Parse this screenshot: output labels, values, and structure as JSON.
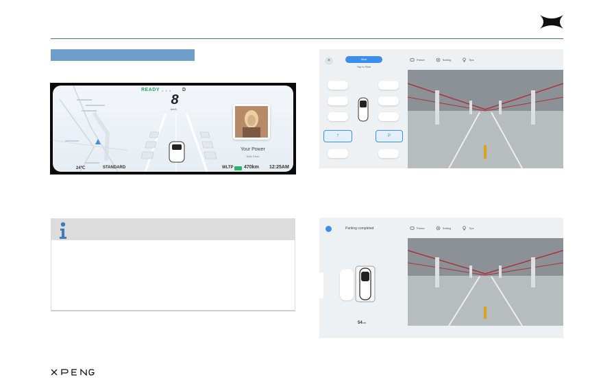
{
  "brand": {
    "wordmark": "XPENG",
    "logo_icon": "xpeng-x-logo"
  },
  "cluster": {
    "ready": "READY",
    "gear": "D",
    "speed": "8",
    "speed_unit": "km/h",
    "song": "Your Power",
    "artist": "Billie Eilish",
    "temperature": "24℃",
    "drive_mode": "STANDARD",
    "range_cycle": "WLTP",
    "range": "470km",
    "time": "12:25AM",
    "battery_color": "#2bb56a",
    "ready_color": "#2aa36b"
  },
  "apa_start": {
    "start_label": "Start",
    "start_sub": "Tap to Start",
    "tabs": [
      "Parker",
      "Setting",
      "Tips"
    ],
    "accent": "#3b8eea"
  },
  "apa_done": {
    "status": "Parking completed",
    "distance": "54",
    "distance_unit": "cm",
    "tabs": [
      "Parker",
      "Setting",
      "Tips"
    ]
  },
  "colors": {
    "rule": "#2b7e93",
    "section_bar": "#6f9fc9",
    "info_head": "#dcdcdc",
    "info_icon": "#3f7db8"
  }
}
